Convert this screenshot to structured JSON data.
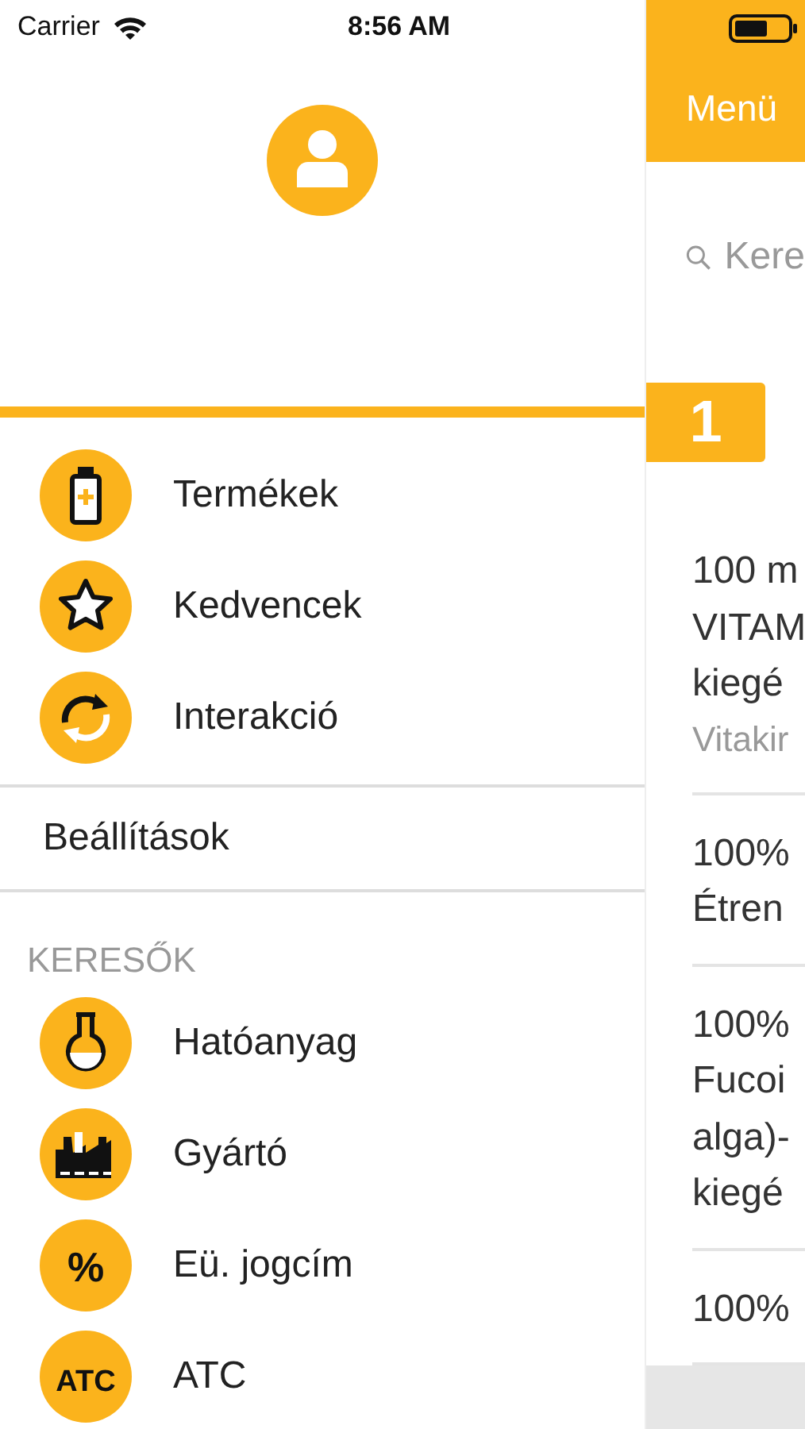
{
  "status_bar": {
    "carrier": "Carrier",
    "time": "8:56 AM"
  },
  "drawer": {
    "primary_items": [
      {
        "label": "Termékek",
        "kind": "bottle"
      },
      {
        "label": "Kedvencek",
        "kind": "star"
      },
      {
        "label": "Interakció",
        "kind": "cycle"
      }
    ],
    "settings": "Beállítások",
    "section_title": "KERESŐK",
    "search_items": [
      {
        "label": "Hatóanyag",
        "kind": "flask"
      },
      {
        "label": "Gyártó",
        "kind": "factory"
      },
      {
        "label": "Eü. jogcím",
        "kind": "text",
        "icon_text": "%"
      },
      {
        "label": "ATC",
        "kind": "text",
        "icon_text": "ATC"
      }
    ]
  },
  "callout": {
    "number": "1"
  },
  "main": {
    "header": {
      "title": "Menü"
    },
    "search": {
      "placeholder": "Kere"
    },
    "results": [
      {
        "lines": [
          "100 m",
          "VITAM",
          "kiegé"
        ],
        "subtitle": "Vitakir"
      },
      {
        "lines": [
          "100%",
          "Étren"
        ]
      },
      {
        "lines": [
          "100%",
          "Fucoi",
          "alga)-",
          "kiegé"
        ]
      },
      {
        "lines": [
          "100%"
        ]
      }
    ]
  }
}
